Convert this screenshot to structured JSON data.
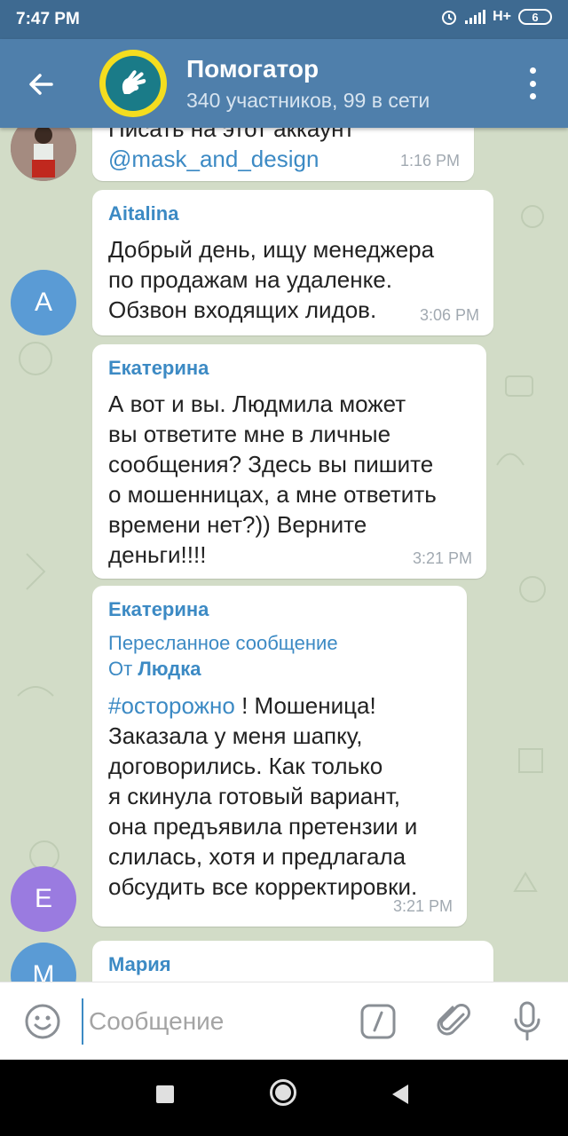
{
  "status_bar": {
    "time": "7:47 PM",
    "network": "H+",
    "battery": "6"
  },
  "header": {
    "title": "Помогатор",
    "subtitle": "340 участников, 99 в сети"
  },
  "messages": [
    {
      "text_partial": "Писать на этот аккаунт",
      "link": "@mask_and_design",
      "time": "1:16 PM"
    },
    {
      "avatar_letter": "A",
      "avatar_color": "#5a9bd5",
      "sender": "Aitalina",
      "text": "Добрый день, ищу менеджера\nпо продажам на удаленке.\nОбзвон входящих лидов.",
      "time": "3:06 PM"
    },
    {
      "sender": "Екатерина",
      "text": "А вот и вы. Людмила может\nвы ответите мне в личные\nсообщения? Здесь вы пишите\nо мошенницах, а мне ответить\nвремени нет?)) Верните\nденьги!!!!",
      "time": "3:21 PM"
    },
    {
      "avatar_letter": "Е",
      "avatar_color": "#9a7be0",
      "sender": "Екатерина",
      "forward_label": "Пересланное сообщение",
      "forward_from_prefix": "От",
      "forward_from": "Людка",
      "hashtag": "#осторожно",
      "text_first": " ! Мошеница!",
      "text": "Заказала у меня шапку,\nдоговорились. Как только\nя скинула готовый вариант,\nона предъявила претензии и\nслилась, хотя и предлагала\nобсудить все корректировки.",
      "time": "3:21 PM"
    },
    {
      "avatar_letter": "М",
      "avatar_color": "#5a9bd5",
      "sender": "Мария"
    }
  ],
  "input": {
    "placeholder": "Сообщение",
    "command_symbol": "/"
  },
  "colors": {
    "header": "#4f7fab",
    "status_bar": "#3e6a91",
    "accent": "#3c8ac4"
  }
}
